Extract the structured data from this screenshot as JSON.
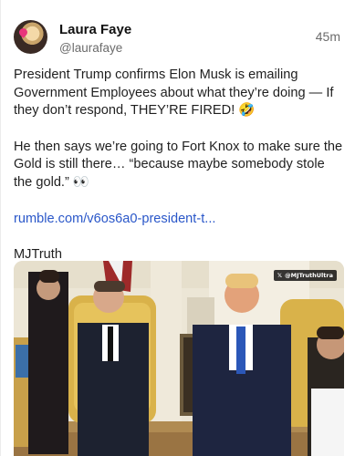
{
  "post": {
    "author": {
      "display_name": "Laura Faye",
      "handle": "@laurafaye"
    },
    "time_ago": "45m",
    "paragraphs": [
      "President Trump confirms Elon Musk is emailing Government Employees about what they’re doing — If they don’t respond, THEY’RE FIRED! 🤣",
      "He then says we’re going to Fort Knox to make sure the Gold is still there… “because maybe somebody stole the gold.” 👀"
    ],
    "link_text": "rumble.com/v6os6a0-president-t...",
    "signature": "MJTruth",
    "media": {
      "watermark_x": "𝕏",
      "watermark_label": "@MJTruthUltra"
    }
  },
  "colors": {
    "link": "#2a57c9",
    "text": "#1f1f1f",
    "muted": "#6b6b6b"
  }
}
